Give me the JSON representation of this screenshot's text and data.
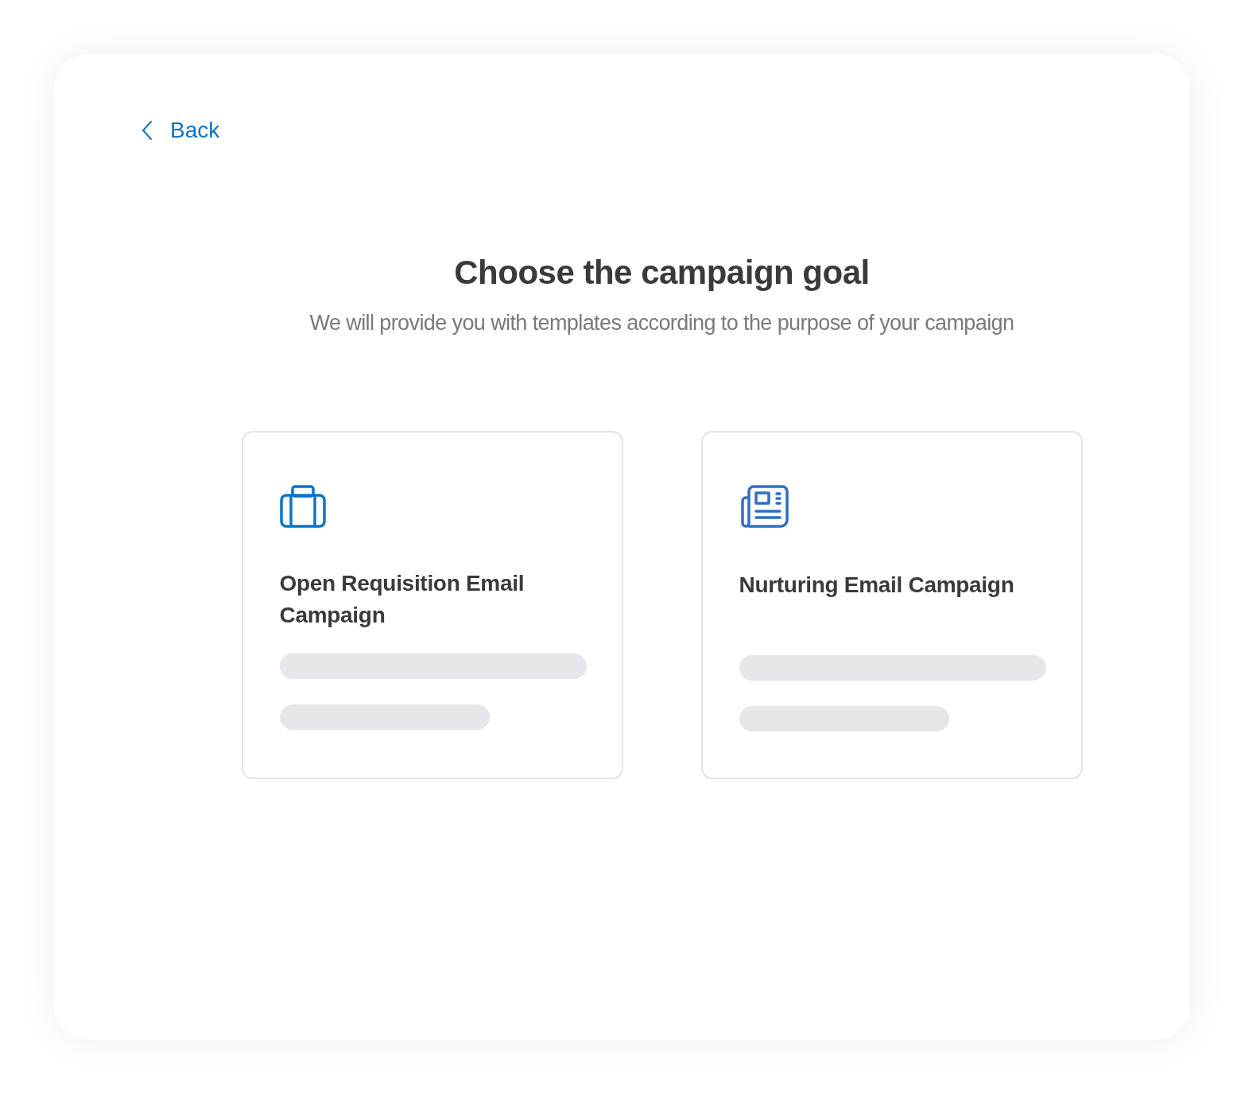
{
  "back_link": {
    "label": "Back"
  },
  "heading": {
    "title": "Choose the campaign goal",
    "subtitle": "We will provide you with templates according to the purpose of your campaign"
  },
  "cards": [
    {
      "kind": "briefcase",
      "title": "Open Requisition Email Campaign"
    },
    {
      "kind": "newspaper",
      "title": "Nurturing Email Campaign"
    }
  ]
}
